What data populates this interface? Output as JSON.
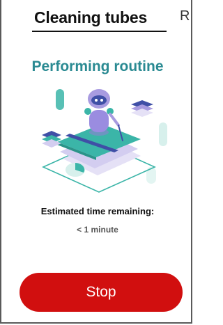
{
  "header": {
    "title": "Cleaning tubes",
    "partial_text": "R"
  },
  "status": {
    "heading": "Performing routine"
  },
  "illustration": {
    "icon": "robot-cleaning-illustration",
    "colors": {
      "teal": "#3bb5a8",
      "lavender": "#a89be0",
      "navy": "#3f4fa6"
    }
  },
  "estimate": {
    "label": "Estimated time remaining:",
    "value": "< 1 minute"
  },
  "actions": {
    "stop_label": "Stop",
    "stop_color": "#d10f0f"
  }
}
